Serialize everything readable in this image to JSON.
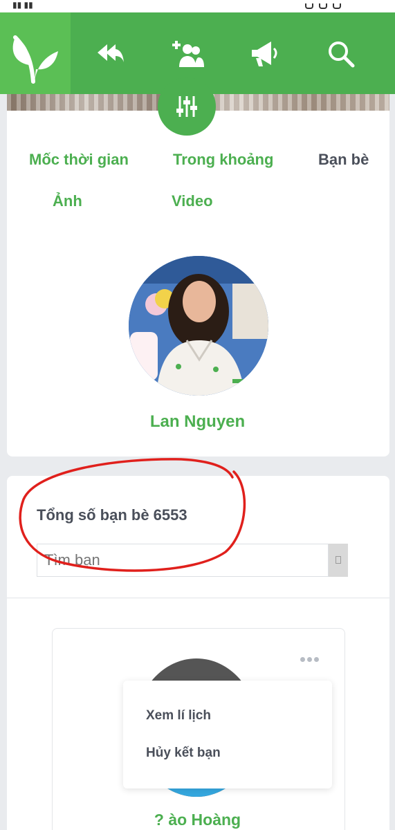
{
  "header": {
    "logo_icon": "leaf-logo-icon",
    "nav": [
      {
        "icon": "reply-all-icon"
      },
      {
        "icon": "add-friend-icon"
      },
      {
        "icon": "megaphone-icon"
      },
      {
        "icon": "search-icon"
      }
    ],
    "accent": "#4caf50"
  },
  "tabs": [
    {
      "label": "Mốc thời gian",
      "active": false
    },
    {
      "label": "Trong khoảng",
      "active": false
    },
    {
      "label": "Bạn bè",
      "active": true
    },
    {
      "label": "Ảnh",
      "active": false
    },
    {
      "label": "Video",
      "active": false
    }
  ],
  "profile": {
    "name": "Lan Nguyen"
  },
  "friends": {
    "total_label": "Tổng số bạn bè 6553",
    "search_placeholder": "Tìm bạn"
  },
  "friend_card": {
    "name": "? ào Hoàng",
    "menu": [
      "Xem lí lịch",
      "Hủy kết bạn"
    ]
  },
  "annotation_color": "#e0201c"
}
